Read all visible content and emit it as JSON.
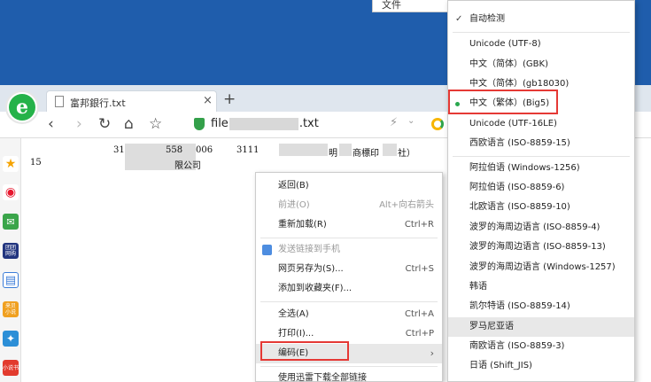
{
  "desktop": {
    "button_label": "文件"
  },
  "tab": {
    "title": "富邦銀行.txt",
    "close": "×",
    "new_tab": "+"
  },
  "toolbar": {
    "back": "‹",
    "forward": "›",
    "reload": "↻",
    "home": "⌂",
    "favorite": "☆",
    "url_prefix": "file",
    "url_suffix": ".txt",
    "bolt": "⚡",
    "chevron": "⌄"
  },
  "sidebar": {
    "items": [
      {
        "name": "favorite-star",
        "color": "#f5a300",
        "label": "★"
      },
      {
        "name": "weibo",
        "color": "#e6162d",
        "label": "◉"
      },
      {
        "name": "mail",
        "color": "#3aa54a",
        "label": "✉"
      },
      {
        "name": "tuan",
        "color": "#22357f",
        "label": "团团 网购"
      },
      {
        "name": "doc",
        "color": "#3c7dd8",
        "label": "▤"
      },
      {
        "name": "game",
        "color": "#f0a020",
        "label": "来贝 小说"
      },
      {
        "name": "bird",
        "color": "#2c8fd7",
        "label": "✦"
      },
      {
        "name": "novel",
        "color": "#e23b2e",
        "label": "小说书"
      }
    ]
  },
  "content": {
    "row1": {
      "c1": "31",
      "c2": "558",
      "c3": "006",
      "c4": "3111",
      "c5": "明",
      "c6": "商標印",
      "c7": "社）"
    },
    "row2": {
      "c1": "15",
      "c2": "限公司"
    }
  },
  "context_menu": {
    "items": [
      {
        "label": "返回(B)",
        "shortcut": "",
        "disabled": false
      },
      {
        "label": "前进(O)",
        "shortcut": "Alt+向右箭头",
        "disabled": true
      },
      {
        "label": "重新加载(R)",
        "shortcut": "Ctrl+R",
        "disabled": false
      },
      {
        "label": "发送链接到手机",
        "shortcut": "",
        "disabled": true
      },
      {
        "label": "网页另存为(S)...",
        "shortcut": "Ctrl+S",
        "disabled": false
      },
      {
        "label": "添加到收藏夹(F)...",
        "shortcut": "",
        "disabled": false
      },
      {
        "label": "全选(A)",
        "shortcut": "Ctrl+A",
        "disabled": false
      },
      {
        "label": "打印(I)...",
        "shortcut": "Ctrl+P",
        "disabled": false
      },
      {
        "label": "编码(E)",
        "shortcut": "",
        "disabled": false
      },
      {
        "label": "使用迅雷下载全部链接",
        "shortcut": "",
        "disabled": false
      }
    ],
    "submenu_arrow": "›"
  },
  "encoding_menu": {
    "check_mark": "✓",
    "items": [
      {
        "label": "自动检测"
      },
      {
        "label": "Unicode (UTF-8)"
      },
      {
        "label": "中文（简体）(GBK)"
      },
      {
        "label": "中文（简体）(gb18030)"
      },
      {
        "label": "中文（繁体）(Big5)"
      },
      {
        "label": "Unicode (UTF-16LE)"
      },
      {
        "label": "西欧语言 (ISO-8859-15)"
      },
      {
        "label": "阿拉伯语 (Windows-1256)"
      },
      {
        "label": "阿拉伯语 (ISO-8859-6)"
      },
      {
        "label": "北欧语言 (ISO-8859-10)"
      },
      {
        "label": "波罗的海周边语言 (ISO-8859-4)"
      },
      {
        "label": "波罗的海周边语言 (ISO-8859-13)"
      },
      {
        "label": "波罗的海周边语言 (Windows-1257)"
      },
      {
        "label": "韩语"
      },
      {
        "label": "凯尔特语 (ISO-8859-14)"
      },
      {
        "label": "罗马尼亚语"
      },
      {
        "label": "南欧语言 (ISO-8859-3)"
      },
      {
        "label": "日语 (Shift_JIS)"
      }
    ]
  },
  "colors": {
    "desktop": "#1f5dac",
    "selected_dot": "#2aa84f",
    "annotation_red": "#e53935",
    "shield_green": "#33a04a"
  }
}
